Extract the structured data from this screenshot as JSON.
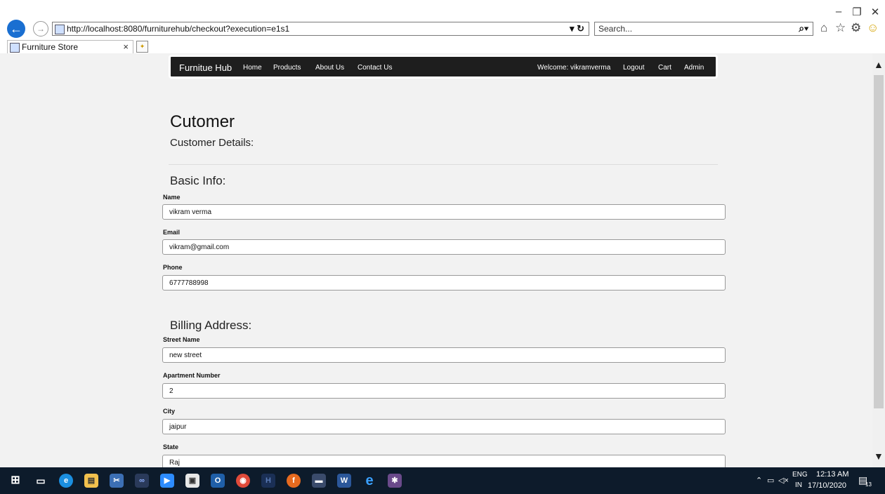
{
  "browser": {
    "url": "http://localhost:8080/furniturehub/checkout?execution=e1s1",
    "search_placeholder": "Search...",
    "tab_title": "Furniture Store",
    "tab_close": "×",
    "window_minimize": "–",
    "window_restore": "❐",
    "window_close": "✕",
    "refresh_control": "▾ ↻",
    "search_icon": "⌕▾"
  },
  "navbar": {
    "brand": "Furnitue Hub",
    "links": [
      "Home",
      "Products",
      "About Us",
      "Contact Us"
    ],
    "welcome": "Welcome: vikramverma",
    "right_links": [
      "Logout",
      "Cart",
      "Admin"
    ]
  },
  "page": {
    "title": "Cutomer",
    "subtitle": "Customer Details:",
    "basic_info": {
      "heading": "Basic Info:",
      "fields": [
        {
          "label": "Name",
          "value": "vikram verma"
        },
        {
          "label": "Email",
          "value": "vikram@gmail.com"
        },
        {
          "label": "Phone",
          "value": "6777788998"
        }
      ]
    },
    "billing": {
      "heading": "Billing Address:",
      "fields": [
        {
          "label": "Street Name",
          "value": "new street"
        },
        {
          "label": "Apartment Number",
          "value": "2"
        },
        {
          "label": "City",
          "value": "jaipur"
        },
        {
          "label": "State",
          "value": "Raj"
        }
      ]
    }
  },
  "taskbar": {
    "lang": "ENG",
    "region": "IN",
    "time": "12:13 AM",
    "date": "17/10/2020",
    "notifications": "13"
  },
  "colors": {
    "navbar_bg": "#1e1e1e",
    "page_bg": "#f2f2f2",
    "taskbar_bg": "#0d1b2b",
    "ie_blue": "#1a6fd1"
  }
}
